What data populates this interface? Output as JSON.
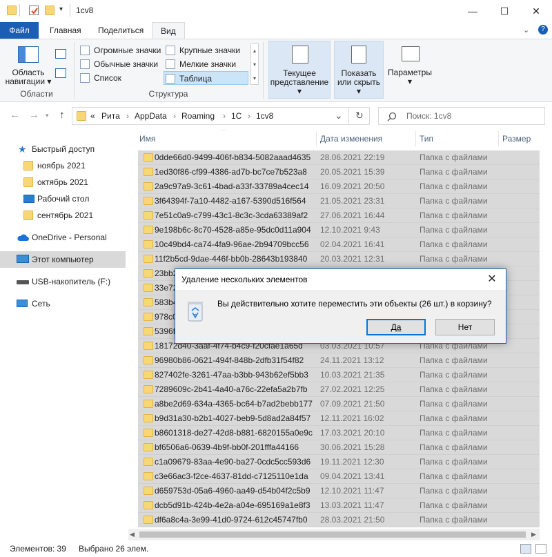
{
  "window": {
    "title": "1cv8",
    "controls": {
      "minimize": "—",
      "maximize": "☐",
      "close": "✕"
    }
  },
  "ribbon_tabs": [
    "Файл",
    "Главная",
    "Поделиться",
    "Вид"
  ],
  "ribbon": {
    "panes": {
      "nav_pane_label_line1": "Область",
      "nav_pane_label_line2": "навигации",
      "group_label": "Области"
    },
    "layout": {
      "items": [
        "Огромные значки",
        "Крупные значки",
        "Обычные значки",
        "Мелкие значки",
        "Список",
        "Таблица"
      ],
      "group_label": "Структура"
    },
    "current_view_line1": "Текущее",
    "current_view_line2": "представление",
    "show_hide_line1": "Показать",
    "show_hide_line2": "или скрыть",
    "options": "Параметры"
  },
  "address": {
    "back": "←",
    "forward": "→",
    "up": "↑",
    "chevron": "«",
    "crumbs": [
      "Рита",
      "AppData",
      "Roaming",
      "1C",
      "1cv8"
    ],
    "separator": "›",
    "dropdown": "⌄",
    "refresh": "↻",
    "search_placeholder": "Поиск: 1cv8"
  },
  "nav_pane": [
    {
      "label": "Быстрый доступ",
      "icon": "star-icon"
    },
    {
      "label": "ноябрь 2021",
      "icon": "folder-icon"
    },
    {
      "label": "октябрь 2021",
      "icon": "folder-icon"
    },
    {
      "label": "Рабочий стол",
      "icon": "desktop-icon"
    },
    {
      "label": "сентябрь 2021",
      "icon": "folder-icon"
    },
    {
      "label": "OneDrive - Personal",
      "icon": "cloud-icon"
    },
    {
      "label": "Этот компьютер",
      "icon": "computer-icon"
    },
    {
      "label": "USB-накопитель (F:)",
      "icon": "usb-drive-icon"
    },
    {
      "label": "Сеть",
      "icon": "network-icon"
    }
  ],
  "columns": [
    "Имя",
    "Дата изменения",
    "Тип",
    "Размер"
  ],
  "files": [
    {
      "name": "0dde66d0-9499-406f-b834-5082aaad4635",
      "date": "28.06.2021 22:19",
      "type": "Папка с файлами"
    },
    {
      "name": "1ed30f86-cf99-4386-ad7b-bc7ce7b523a8",
      "date": "20.05.2021 15:39",
      "type": "Папка с файлами"
    },
    {
      "name": "2a9c97a9-3c61-4bad-a33f-33789a4cec14",
      "date": "16.09.2021 20:50",
      "type": "Папка с файлами"
    },
    {
      "name": "3f64394f-7a10-4482-a167-5390d516f564",
      "date": "21.05.2021 23:31",
      "type": "Папка с файлами"
    },
    {
      "name": "7e51c0a9-c799-43c1-8c3c-3cda63389af2",
      "date": "27.06.2021 16:44",
      "type": "Папка с файлами"
    },
    {
      "name": "9e198b6c-8c70-4528-a85e-95dc0d11a904",
      "date": "12.10.2021 9:43",
      "type": "Папка с файлами"
    },
    {
      "name": "10c49bd4-ca74-4fa9-96ae-2b94709bcc56",
      "date": "02.04.2021 16:41",
      "type": "Папка с файлами"
    },
    {
      "name": "11f2b5cd-9dae-446f-bb0b-28643b193840",
      "date": "20.03.2021 12:31",
      "type": "Папка с файлами"
    },
    {
      "name": "23bb2",
      "date": "",
      "type": ""
    },
    {
      "name": "33e72",
      "date": "",
      "type": ""
    },
    {
      "name": "583b4",
      "date": "",
      "type": ""
    },
    {
      "name": "978c0",
      "date": "",
      "type": ""
    },
    {
      "name": "5396f",
      "date": "",
      "type": ""
    },
    {
      "name": "18172d40-3aaf-4f74-b4c9-f20cfae1a65d",
      "date": "03.03.2021 10:57",
      "type": "Папка с файлами"
    },
    {
      "name": "96980b86-0621-494f-848b-2dfb31f54f82",
      "date": "24.11.2021 13:12",
      "type": "Папка с файлами"
    },
    {
      "name": "827402fe-3261-47aa-b3bb-943b62ef5bb3",
      "date": "10.03.2021 21:35",
      "type": "Папка с файлами"
    },
    {
      "name": "7289609c-2b41-4a40-a76c-22efa5a2b7fb",
      "date": "27.02.2021 12:25",
      "type": "Папка с файлами"
    },
    {
      "name": "a8be2d69-634a-4365-bc64-b7ad2bebb177",
      "date": "07.09.2021 21:50",
      "type": "Папка с файлами"
    },
    {
      "name": "b9d31a30-b2b1-4027-beb9-5d8ad2a84f57",
      "date": "12.11.2021 16:02",
      "type": "Папка с файлами"
    },
    {
      "name": "b8601318-de27-42d8-b881-6820155a0e9c",
      "date": "17.03.2021 20:10",
      "type": "Папка с файлами"
    },
    {
      "name": "bf6506a6-0639-4b9f-bb0f-201fffa44166",
      "date": "30.06.2021 15:28",
      "type": "Папка с файлами"
    },
    {
      "name": "c1a09679-83aa-4e90-ba27-0cdc5cc593d6",
      "date": "19.11.2021 12:30",
      "type": "Папка с файлами"
    },
    {
      "name": "c3e66ac3-f2ce-4637-81dd-c7125110e1da",
      "date": "09.04.2021 13:41",
      "type": "Папка с файлами"
    },
    {
      "name": "d659753d-05a6-4960-aa49-d54b04f2c5b9",
      "date": "12.10.2021 11:47",
      "type": "Папка с файлами"
    },
    {
      "name": "dcb5d91b-424b-4e2a-a04e-695169a1e8f3",
      "date": "13.03.2021 11:47",
      "type": "Папка с файлами"
    },
    {
      "name": "df6a8c4a-3e99-41d0-9724-612c45747fb0",
      "date": "28.03.2021 21:50",
      "type": "Папка с файлами"
    }
  ],
  "status": {
    "items": "Элементов: 39",
    "selected": "Выбрано 26 элем."
  },
  "dialog": {
    "title": "Удаление нескольких элементов",
    "message": "Вы действительно хотите переместить эти объекты (26 шт.) в корзину?",
    "yes": "Да",
    "no": "Нет",
    "close": "✕"
  },
  "colors": {
    "accent": "#1a5fb4",
    "selection": "#d9d9d9",
    "folder": "#f8d775"
  }
}
